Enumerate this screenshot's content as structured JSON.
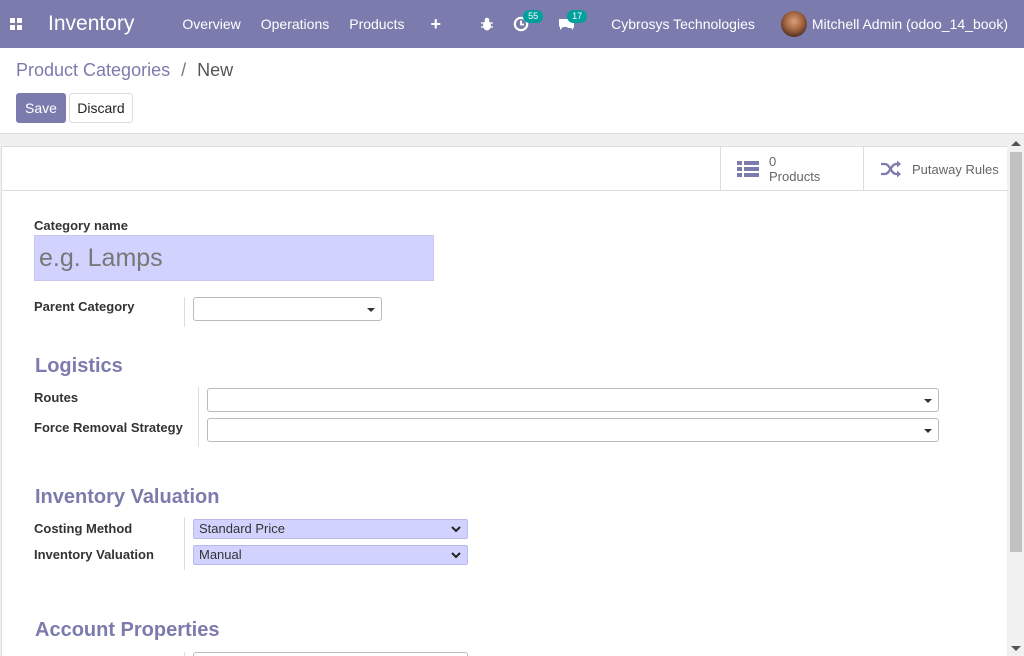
{
  "navbar": {
    "app_title": "Inventory",
    "menu": [
      "Overview",
      "Operations",
      "Products"
    ],
    "activity_count": "55",
    "messages_count": "17",
    "company": "Cybrosys Technologies",
    "user": "Mitchell Admin (odoo_14_book)"
  },
  "breadcrumb": {
    "parent": "Product Categories",
    "separator": "/",
    "current": "New"
  },
  "buttons": {
    "save": "Save",
    "discard": "Discard"
  },
  "smart_buttons": {
    "products_count": "0",
    "products_label": "Products",
    "putaway_label": "Putaway Rules"
  },
  "form": {
    "category_name_label": "Category name",
    "category_name_placeholder": "e.g. Lamps",
    "parent_category_label": "Parent Category",
    "logistics_title": "Logistics",
    "routes_label": "Routes",
    "removal_label": "Force Removal Strategy",
    "valuation_title": "Inventory Valuation",
    "costing_label": "Costing Method",
    "costing_value": "Standard Price",
    "valuation_label": "Inventory Valuation",
    "valuation_value": "Manual",
    "account_title": "Account Properties"
  },
  "colors": {
    "brand": "#7c7bad",
    "required_field": "#d2d2ff",
    "badge": "#00a09d"
  },
  "icons": [
    "apps-icon",
    "plus-icon",
    "bug-icon",
    "activity-icon",
    "messages-icon",
    "avatar",
    "list-icon",
    "shuffle-icon",
    "caret-down-icon",
    "chevron-down-icon"
  ]
}
